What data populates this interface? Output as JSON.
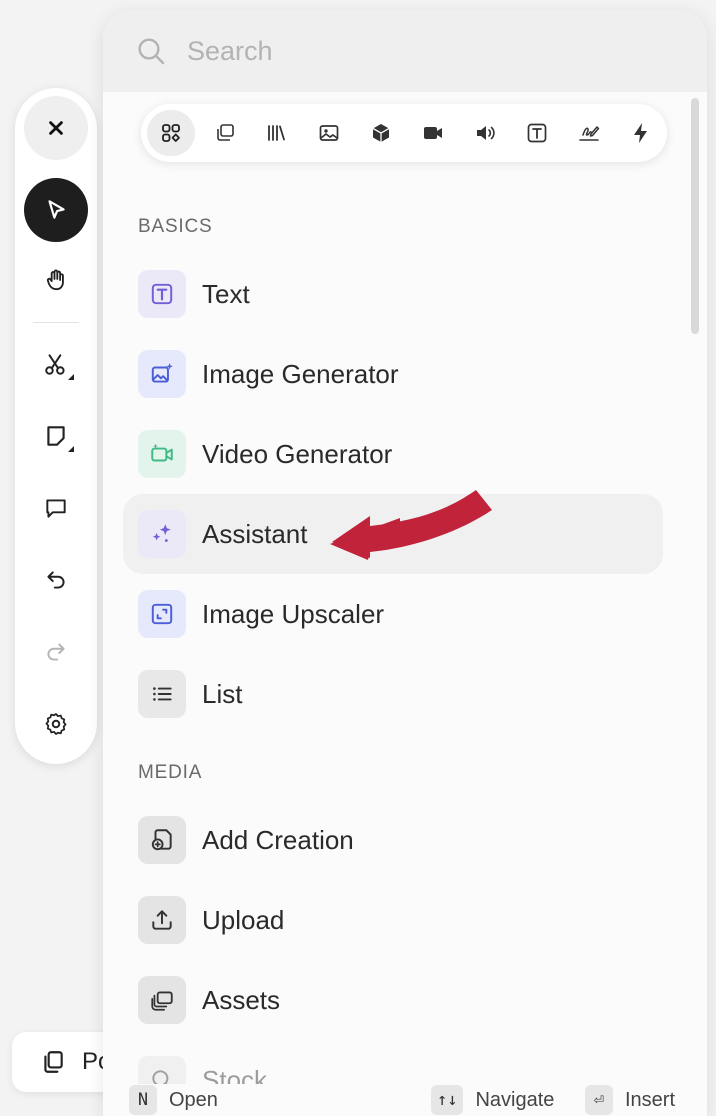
{
  "search": {
    "placeholder": "Search"
  },
  "filters": [
    {
      "icon": "grid-icon",
      "active": true
    },
    {
      "icon": "stack-icon"
    },
    {
      "icon": "library-icon"
    },
    {
      "icon": "image-icon"
    },
    {
      "icon": "cube-icon"
    },
    {
      "icon": "video-camera-icon"
    },
    {
      "icon": "speaker-icon"
    },
    {
      "icon": "text-box-icon"
    },
    {
      "icon": "pen-sign-icon"
    },
    {
      "icon": "lightning-icon"
    }
  ],
  "sections": {
    "basics": {
      "title": "BASICS",
      "items": [
        {
          "label": "Text",
          "icon": "text-icon",
          "bg": "#ebe8f8",
          "color": "#6f5fd8"
        },
        {
          "label": "Image Generator",
          "icon": "image-generator-icon",
          "bg": "#e6e9fb",
          "color": "#4b5ed8"
        },
        {
          "label": "Video Generator",
          "icon": "video-generator-icon",
          "bg": "#e3f4ec",
          "color": "#3dbb82"
        },
        {
          "label": "Assistant",
          "icon": "sparkles-icon",
          "bg": "#ebe8f8",
          "color": "#6f5fd8"
        },
        {
          "label": "Image Upscaler",
          "icon": "upscale-icon",
          "bg": "#e6e9fb",
          "color": "#4b5ed8"
        },
        {
          "label": "List",
          "icon": "list-icon",
          "bg": "#e8e8e8",
          "color": "#333333"
        }
      ]
    },
    "media": {
      "title": "MEDIA",
      "items": [
        {
          "label": "Add Creation",
          "icon": "add-creation-icon"
        },
        {
          "label": "Upload",
          "icon": "upload-icon"
        },
        {
          "label": "Assets",
          "icon": "assets-icon"
        },
        {
          "label": "Stock",
          "icon": "search-icon"
        }
      ]
    }
  },
  "footer": {
    "open_key": "N",
    "open_label": "Open",
    "navigate_key": "↑↓",
    "navigate_label": "Navigate",
    "insert_key": "⏎",
    "insert_label": "Insert"
  },
  "pill": {
    "label": "Po"
  },
  "colors": {
    "highlight_arrow": "#c0233a",
    "toolbar_active": "#1e1e1e"
  }
}
